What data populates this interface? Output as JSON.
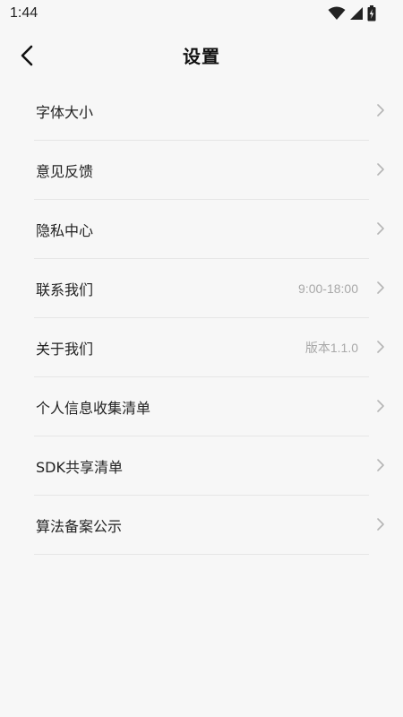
{
  "status_bar": {
    "time": "1:44",
    "icons": [
      "wifi-icon",
      "signal-icon",
      "battery-icon"
    ]
  },
  "header": {
    "title": "设置",
    "back_icon": "chevron-left-icon"
  },
  "settings": {
    "items": [
      {
        "label": "字体大小",
        "value": ""
      },
      {
        "label": "意见反馈",
        "value": ""
      },
      {
        "label": "隐私中心",
        "value": ""
      },
      {
        "label": "联系我们",
        "value": "9:00-18:00"
      },
      {
        "label": "关于我们",
        "value": "版本1.1.0"
      },
      {
        "label": "个人信息收集清单",
        "value": ""
      },
      {
        "label": "SDK共享清单",
        "value": ""
      },
      {
        "label": "算法备案公示",
        "value": ""
      }
    ]
  },
  "colors": {
    "background": "#f7f7f7",
    "divider": "#e6e6e6",
    "text_primary": "#222222",
    "text_secondary": "#a8a8a8",
    "chevron": "#b5b5b5"
  }
}
